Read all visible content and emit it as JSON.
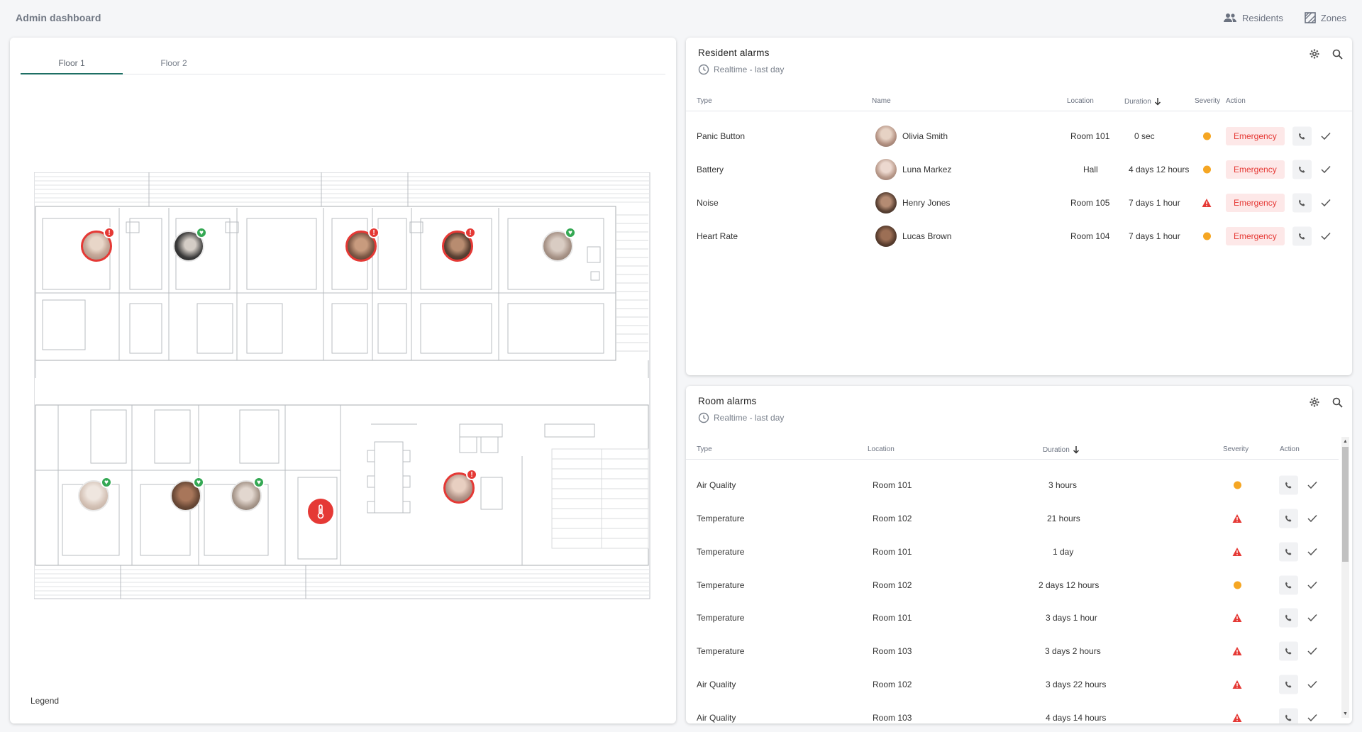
{
  "app": {
    "title": "Admin dashboard"
  },
  "top_actions": {
    "residents": "Residents",
    "zones": "Zones"
  },
  "map": {
    "tabs": [
      "Floor 1",
      "Floor 2"
    ],
    "active_tab": "Floor 1",
    "legend": "Legend"
  },
  "resident_alarms": {
    "title": "Resident alarms",
    "subtitle": "Realtime - last day",
    "headers": {
      "type": "Type",
      "name": "Name",
      "location": "Location",
      "duration": "Duration",
      "severity": "Severity",
      "action": "Action"
    },
    "rows": [
      {
        "type": "Panic Button",
        "name": "Olivia Smith",
        "location": "Room 101",
        "duration": "0 sec",
        "severity": "warning",
        "action": "Emergency"
      },
      {
        "type": "Battery",
        "name": "Luna Markez",
        "location": "Hall",
        "duration": "4 days 12 hours",
        "severity": "warning",
        "action": "Emergency"
      },
      {
        "type": "Noise",
        "name": "Henry Jones",
        "location": "Room 105",
        "duration": "7 days 1 hour",
        "severity": "critical",
        "action": "Emergency"
      },
      {
        "type": "Heart Rate",
        "name": "Lucas Brown",
        "location": "Room 104",
        "duration": "7 days 1 hour",
        "severity": "warning",
        "action": "Emergency"
      }
    ]
  },
  "room_alarms": {
    "title": "Room alarms",
    "subtitle": "Realtime - last day",
    "headers": {
      "type": "Type",
      "location": "Location",
      "duration": "Duration",
      "severity": "Severity",
      "action": "Action"
    },
    "rows": [
      {
        "type": "Air Quality",
        "location": "Room 101",
        "duration": "3 hours",
        "severity": "warning"
      },
      {
        "type": "Temperature",
        "location": "Room 102",
        "duration": "21 hours",
        "severity": "critical"
      },
      {
        "type": "Temperature",
        "location": "Room 101",
        "duration": "1 day",
        "severity": "critical"
      },
      {
        "type": "Temperature",
        "location": "Room 102",
        "duration": "2 days 12 hours",
        "severity": "warning"
      },
      {
        "type": "Temperature",
        "location": "Room 101",
        "duration": "3 days 1 hour",
        "severity": "critical"
      },
      {
        "type": "Temperature",
        "location": "Room 103",
        "duration": "3 days 2 hours",
        "severity": "critical"
      },
      {
        "type": "Air Quality",
        "location": "Room 102",
        "duration": "3 days 22 hours",
        "severity": "critical"
      },
      {
        "type": "Air Quality",
        "location": "Room 103",
        "duration": "4 days 14 hours",
        "severity": "critical"
      }
    ]
  },
  "colors": {
    "accent": "#1e6f64",
    "alert_red": "#e53935",
    "ok_green": "#34a853",
    "warning_orange": "#f5a623",
    "emergency_bg": "#fde8e8"
  },
  "icons": {
    "residents": "people-icon",
    "zones": "zones-icon",
    "clock": "clock-icon",
    "settings": "gear-icon",
    "search": "search-icon",
    "sort": "arrow-down-icon",
    "call": "phone-icon",
    "acknowledge": "check-icon",
    "temperature": "thermometer-icon"
  }
}
